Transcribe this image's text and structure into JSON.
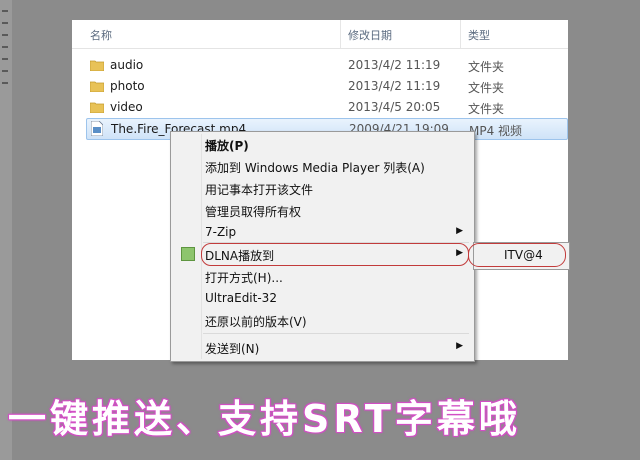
{
  "columns": {
    "name": "名称",
    "date": "修改日期",
    "type": "类型"
  },
  "files": [
    {
      "name": "audio",
      "date": "2013/4/2 11:19",
      "type": "文件夹",
      "icon": "folder-icon"
    },
    {
      "name": "photo",
      "date": "2013/4/2 11:19",
      "type": "文件夹",
      "icon": "folder-icon"
    },
    {
      "name": "video",
      "date": "2013/4/5 20:05",
      "type": "文件夹",
      "icon": "folder-icon"
    },
    {
      "name": "The.Fire_Forecast.mp4",
      "date": "2009/4/21 19:09",
      "type": "MP4 视频",
      "icon": "video-file-icon"
    }
  ],
  "context_menu": {
    "play": "播放(P)",
    "add_to_wmp": "添加到 Windows Media Player 列表(A)",
    "open_notepad": "用记事本打开该文件",
    "take_ownership": "管理员取得所有权",
    "seven_zip": "7-Zip",
    "dlna_play": "DLNA播放到",
    "open_with": "打开方式(H)...",
    "ultraedit": "UltraEdit-32",
    "restore_versions": "还原以前的版本(V)",
    "send_to": "发送到(N)"
  },
  "submenu": {
    "device": "ITV@4"
  },
  "caption": "一键推送、支持SRT字幕哦",
  "colors": {
    "highlight_ring": "#c23b3b",
    "caption_glow": "#d24fc5",
    "selection": "#cfe3f8"
  }
}
